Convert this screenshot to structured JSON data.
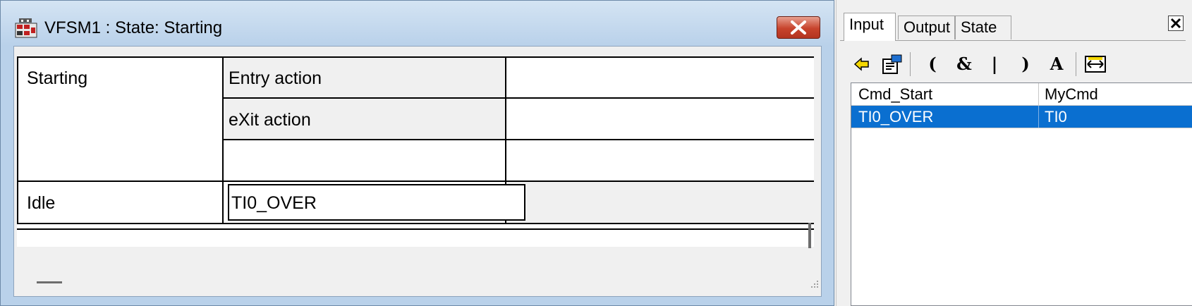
{
  "window": {
    "title": "VFSM1 : State: Starting",
    "icons": {
      "app": "vfsm-app-icon",
      "close": "close-icon"
    },
    "table": {
      "state_name": "Starting",
      "entry_action_label": "Entry action",
      "exit_action_label": "eXit action",
      "entry_action_value": "",
      "exit_action_value": "",
      "empty_label": "",
      "next_state": "Idle",
      "transition_condition": "TI0_OVER"
    }
  },
  "panel": {
    "tabs": [
      {
        "label": "Input",
        "active": true
      },
      {
        "label": "Output",
        "active": false
      },
      {
        "label": "State",
        "active": false
      }
    ],
    "close_icon": "close-icon",
    "toolbar": {
      "back": "arrow-left-icon",
      "properties": "properties-icon",
      "open_paren": "(",
      "and": "&",
      "or": "|",
      "close_paren": ")",
      "text": "A",
      "range": "range-icon"
    },
    "list": {
      "rows": [
        {
          "name": "Cmd_Start",
          "value": "MyCmd",
          "selected": false
        },
        {
          "name": "TI0_OVER",
          "value": "TI0",
          "selected": true
        }
      ]
    },
    "selection_color": "#0a6fd0"
  }
}
